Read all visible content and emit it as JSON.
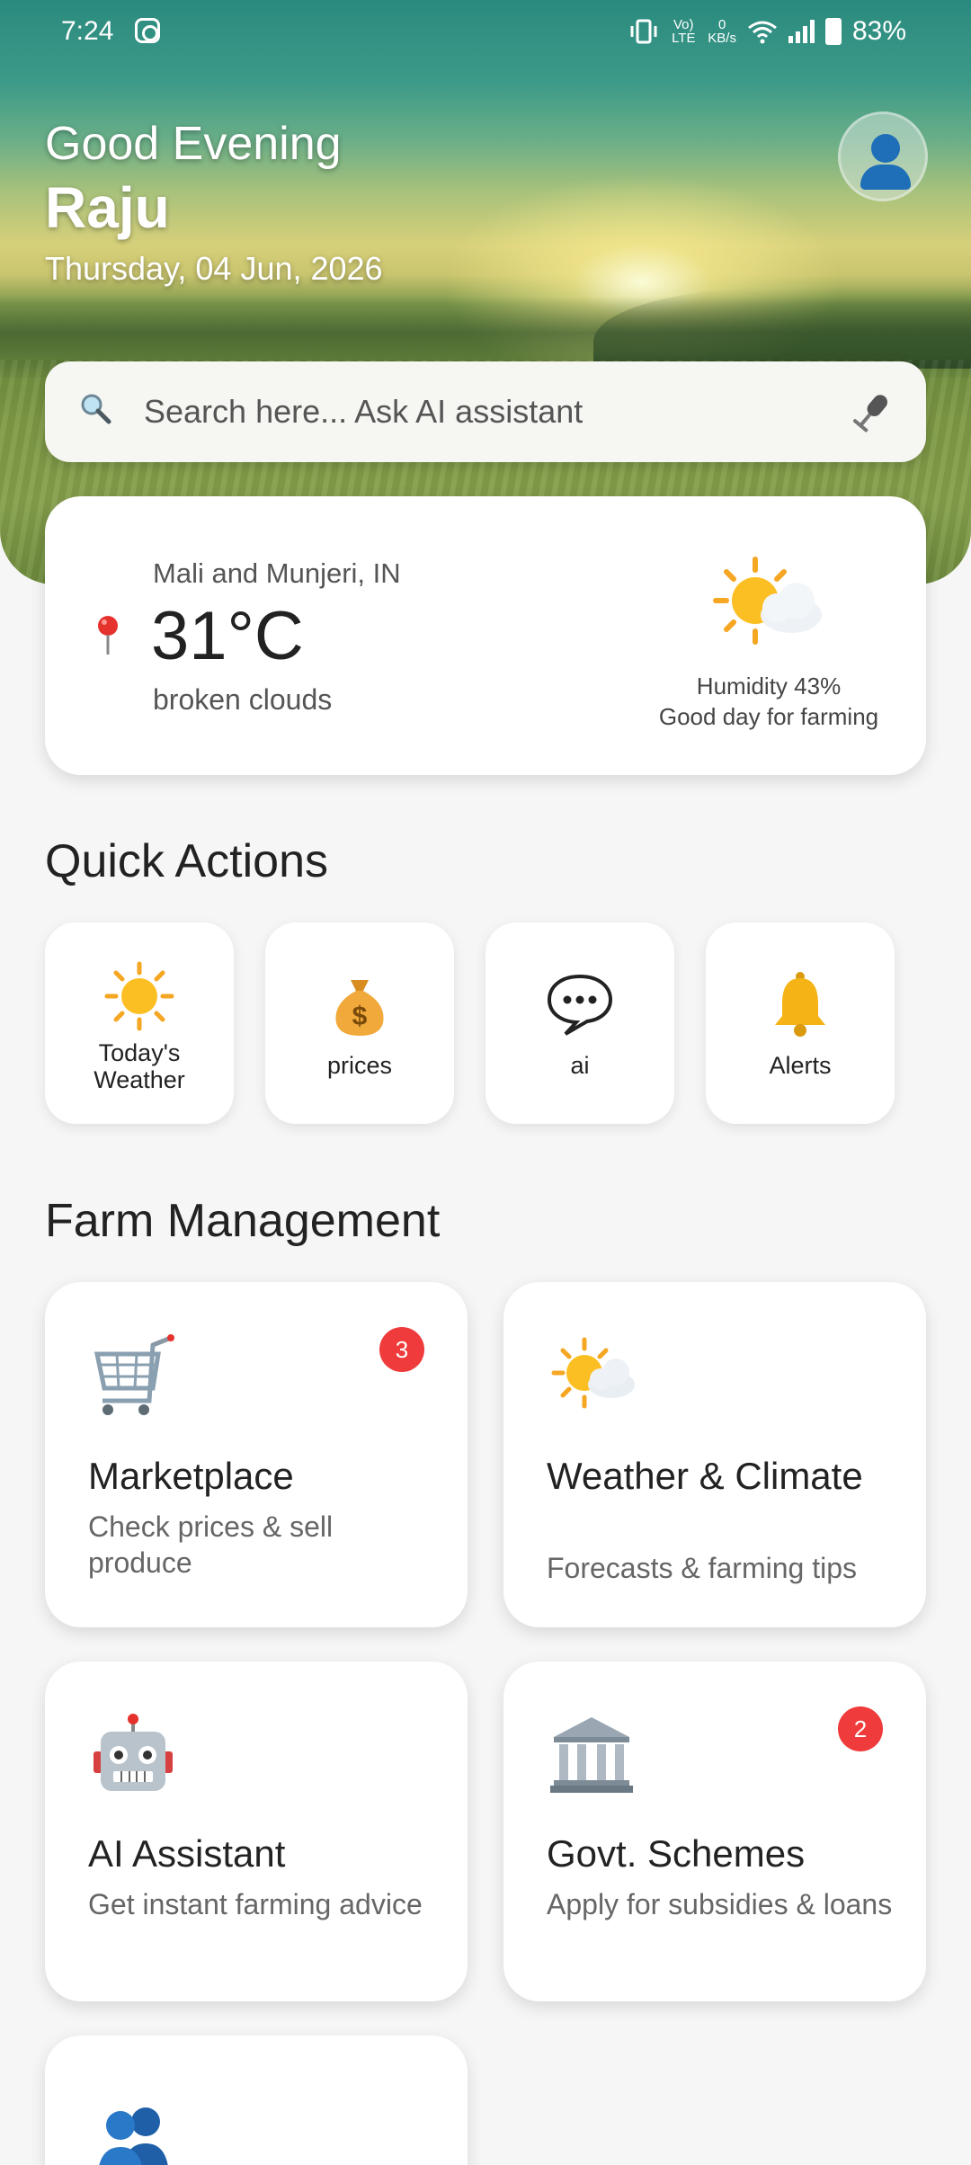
{
  "status_bar": {
    "time": "7:24",
    "network_top": "0",
    "network_unit": "KB/s",
    "volte": "Vo) LTE",
    "battery": "83%"
  },
  "header": {
    "greeting": "Good Evening",
    "user_name": "Raju",
    "date": "Thursday, 04 Jun, 2026"
  },
  "search": {
    "placeholder": "Search here... Ask AI assistant"
  },
  "weather": {
    "location": "Mali and Munjeri, IN",
    "temperature": "31°C",
    "description": "broken clouds",
    "humidity": "Humidity 43%",
    "advice": "Good day for farming"
  },
  "quick_actions": {
    "heading": "Quick Actions",
    "items": [
      {
        "icon": "sun-icon",
        "label_line1": "Today's",
        "label_line2": "Weather"
      },
      {
        "icon": "money-bag-icon",
        "label": "prices"
      },
      {
        "icon": "speech-bubble-icon",
        "label": "ai"
      },
      {
        "icon": "bell-icon",
        "label": "Alerts"
      }
    ]
  },
  "farm_management": {
    "heading": "Farm Management",
    "cards": [
      {
        "icon": "shopping-cart-icon",
        "title": "Marketplace",
        "subtitle": "Check prices & sell produce",
        "badge": "3"
      },
      {
        "icon": "sun-behind-cloud-icon",
        "title": "Weather & Climate",
        "subtitle": "Forecasts & farming tips"
      },
      {
        "icon": "robot-icon",
        "title": "AI Assistant",
        "subtitle": "Get instant farming advice"
      },
      {
        "icon": "government-building-icon",
        "title": "Govt. Schemes",
        "subtitle": "Apply for subsidies & loans",
        "badge": "2"
      },
      {
        "icon": "people-icon"
      }
    ]
  },
  "colors": {
    "background": "#f5f6f5",
    "card": "#ffffff",
    "badge": "#ef3b3b",
    "avatar": "#1f6fb8"
  }
}
